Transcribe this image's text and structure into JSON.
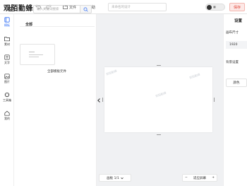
{
  "header": {
    "logo": "观陌勤蜂",
    "file_label": "文件",
    "help_label": "帮助",
    "title_placeholder": "未命名的设计",
    "toggle_label": "■",
    "save_label": "保存"
  },
  "nav": {
    "items": [
      {
        "label": "模板",
        "icon": "template-icon",
        "active": true
      },
      {
        "label": "素材",
        "icon": "material-icon",
        "active": false
      },
      {
        "label": "文字",
        "icon": "text-icon",
        "active": false
      },
      {
        "label": "图片",
        "icon": "image-icon",
        "active": false
      },
      {
        "label": "工具箱",
        "icon": "toolbox-icon",
        "active": false
      },
      {
        "label": "我的",
        "icon": "home-icon",
        "active": false
      }
    ]
  },
  "panel": {
    "search_placeholder": "输入关键词搜索",
    "section_title": "全部",
    "template_caption": "全部模板元件"
  },
  "canvas": {
    "watermarks": [
      "观陌勤蜂",
      "观陌勤蜂",
      "观陌勤蜂"
    ]
  },
  "bottom": {
    "page_label": "画板 1/1",
    "zoom_minus": "−",
    "zoom_label": "适应屏幕",
    "zoom_plus": "+"
  },
  "right": {
    "title": "设置",
    "canvas_size_label": "画布尺寸",
    "width_value": "1920",
    "bg_label": "背景设置",
    "color_button": "颜色"
  },
  "colors": {
    "accent": "#2d6cf6",
    "save": "#e0483c"
  }
}
